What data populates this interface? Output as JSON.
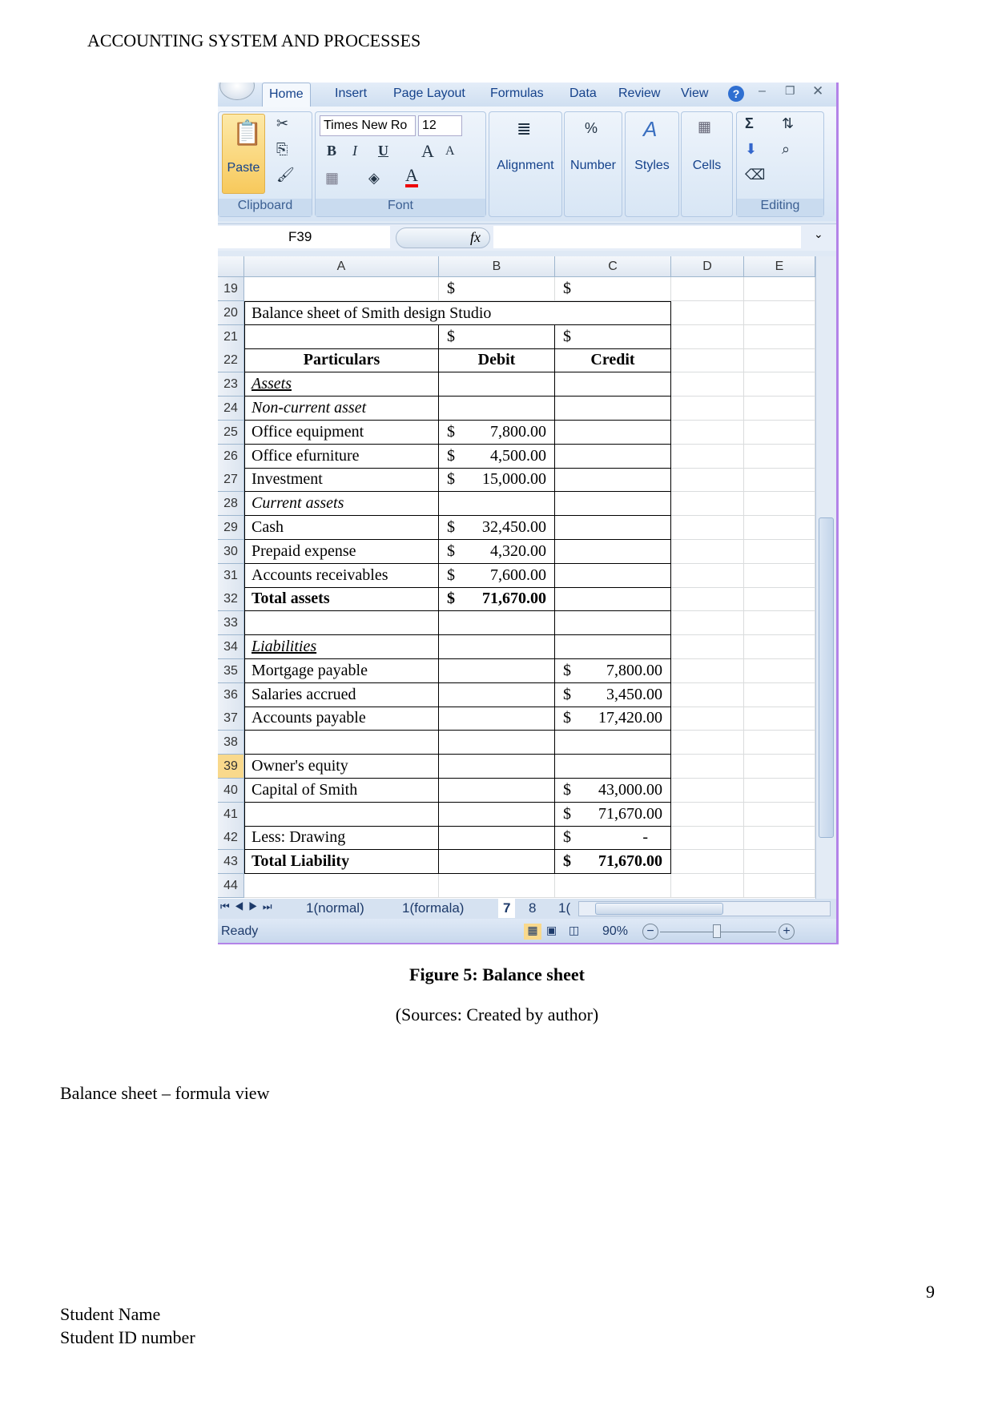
{
  "header": "ACCOUNTING SYSTEM AND PROCESSES",
  "excel": {
    "tabs": [
      "Home",
      "Insert",
      "Page Layout",
      "Formulas",
      "Data",
      "Review",
      "View"
    ],
    "groups": {
      "clipboard": "Clipboard",
      "paste": "Paste",
      "font": "Font",
      "font_name": "Times New Ro",
      "font_size": "12",
      "alignment": "Alignment",
      "number": "Number",
      "styles": "Styles",
      "cells": "Cells",
      "editing": "Editing"
    },
    "name_box": "F39",
    "fx": "fx",
    "formula": "",
    "columns": [
      "A",
      "B",
      "C",
      "D",
      "E"
    ],
    "selected_row": 39,
    "rows": [
      {
        "n": 19,
        "a": "",
        "b": "",
        "c": ""
      },
      {
        "n": 20,
        "a": "Balance sheet of Smith design Studio",
        "merged": true
      },
      {
        "n": 21,
        "a": "",
        "b": "",
        "c": ""
      },
      {
        "n": 22,
        "a": "Particulars",
        "b": "Debit",
        "c": "Credit",
        "style": "header"
      },
      {
        "n": 23,
        "a": "Assets",
        "style": "italic-underline"
      },
      {
        "n": 24,
        "a": "Non-current asset",
        "style": "italic"
      },
      {
        "n": 25,
        "a": "Office equipment",
        "b": "7,800.00"
      },
      {
        "n": 26,
        "a": "Office efurniture",
        "b": "4,500.00"
      },
      {
        "n": 27,
        "a": "Investment",
        "b": "15,000.00"
      },
      {
        "n": 28,
        "a": "Current assets",
        "style": "italic"
      },
      {
        "n": 29,
        "a": "Cash",
        "b": "32,450.00"
      },
      {
        "n": 30,
        "a": "Prepaid expense",
        "b": "4,320.00"
      },
      {
        "n": 31,
        "a": "Accounts receivables",
        "b": "7,600.00"
      },
      {
        "n": 32,
        "a": "Total assets",
        "b": "71,670.00",
        "style": "bold"
      },
      {
        "n": 33,
        "a": ""
      },
      {
        "n": 34,
        "a": "Liabilities",
        "style": "italic-underline"
      },
      {
        "n": 35,
        "a": "Mortgage payable",
        "c": "7,800.00"
      },
      {
        "n": 36,
        "a": "Salaries accrued",
        "c": "3,450.00"
      },
      {
        "n": 37,
        "a": "Accounts payable",
        "c": "17,420.00"
      },
      {
        "n": 38,
        "a": ""
      },
      {
        "n": 39,
        "a": "Owner's equity"
      },
      {
        "n": 40,
        "a": "Capital of Smith",
        "c": "43,000.00"
      },
      {
        "n": 41,
        "a": "",
        "c": "71,670.00"
      },
      {
        "n": 42,
        "a": "Less: Drawing",
        "c": "-"
      },
      {
        "n": 43,
        "a": "Total Liability",
        "c": "71,670.00",
        "style": "bold"
      },
      {
        "n": 44,
        "a": "",
        "blank": true
      }
    ],
    "currency": "$",
    "sheet_tabs": [
      "1(normal)",
      "1(formala)",
      "7",
      "8",
      "1("
    ],
    "active_sheet": "7",
    "status": "Ready",
    "zoom": "90%"
  },
  "caption": "Figure 5: Balance sheet",
  "source": "(Sources: Created by author)",
  "section": "Balance sheet – formula view",
  "page_number": "9",
  "footer": {
    "name": "Student Name",
    "id": "Student ID number"
  }
}
